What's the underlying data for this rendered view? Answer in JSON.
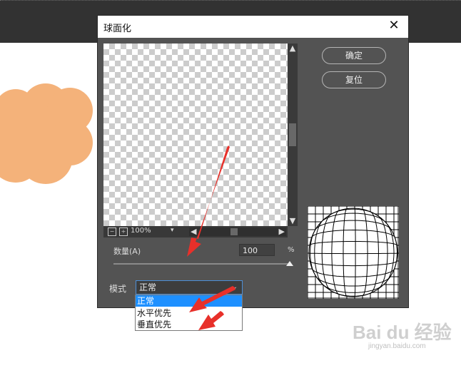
{
  "dialog": {
    "title": "球面化",
    "close_icon": "close-icon",
    "ok_label": "确定",
    "reset_label": "复位"
  },
  "preview": {
    "zoom": "100%",
    "minus_icon": "zoom-out-icon",
    "plus_icon": "zoom-in-icon"
  },
  "amount": {
    "label": "数量(A)",
    "value": "100",
    "unit": "%",
    "slider_fraction": 1.0
  },
  "mode": {
    "label": "模式",
    "selected": "正常",
    "options": [
      "正常",
      "水平优先",
      "垂直优先"
    ]
  },
  "watermark": {
    "brand": "Bai du 经验",
    "url": "jingyan.baidu.com"
  },
  "colors": {
    "dialog_bg": "#535353",
    "shape_fill": "#f4b27a",
    "selection": "#1e90ff",
    "annotation_arrow": "#e8302a"
  }
}
